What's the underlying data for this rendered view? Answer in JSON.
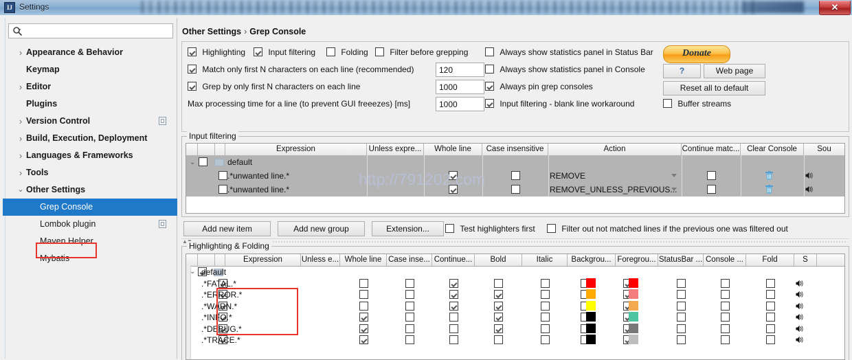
{
  "window": {
    "title": "Settings",
    "app_icon": "intellij-idea-icon",
    "close_label": "✕"
  },
  "sidebar": {
    "search": {
      "placeholder": "",
      "value": "",
      "icon": "search-icon"
    },
    "items": [
      {
        "label": "Appearance & Behavior",
        "level": 0,
        "arrow": "›",
        "selected": false,
        "copy_icon": false
      },
      {
        "label": "Keymap",
        "level": 0,
        "arrow": "",
        "selected": false,
        "copy_icon": false
      },
      {
        "label": "Editor",
        "level": 0,
        "arrow": "›",
        "selected": false,
        "copy_icon": false
      },
      {
        "label": "Plugins",
        "level": 0,
        "arrow": "",
        "selected": false,
        "copy_icon": false
      },
      {
        "label": "Version Control",
        "level": 0,
        "arrow": "›",
        "selected": false,
        "copy_icon": true
      },
      {
        "label": "Build, Execution, Deployment",
        "level": 0,
        "arrow": "›",
        "selected": false,
        "copy_icon": false
      },
      {
        "label": "Languages & Frameworks",
        "level": 0,
        "arrow": "›",
        "selected": false,
        "copy_icon": false
      },
      {
        "label": "Tools",
        "level": 0,
        "arrow": "›",
        "selected": false,
        "copy_icon": false
      },
      {
        "label": "Other Settings",
        "level": 0,
        "arrow": "⌄",
        "selected": false,
        "copy_icon": false
      },
      {
        "label": "Grep Console",
        "level": 1,
        "arrow": "",
        "selected": true,
        "copy_icon": false
      },
      {
        "label": "Lombok plugin",
        "level": 1,
        "arrow": "",
        "selected": false,
        "copy_icon": true
      },
      {
        "label": "Maven Helper",
        "level": 1,
        "arrow": "",
        "selected": false,
        "copy_icon": false
      },
      {
        "label": "Mybatis",
        "level": 1,
        "arrow": "",
        "selected": false,
        "copy_icon": false
      }
    ]
  },
  "breadcrumb": {
    "parent": "Other Settings",
    "separator": "›",
    "current": "Grep Console"
  },
  "options": {
    "row1": [
      {
        "label": "Highlighting",
        "checked": true
      },
      {
        "label": "Input filtering",
        "checked": true
      },
      {
        "label": "Folding",
        "checked": false
      },
      {
        "label": "Filter before grepping",
        "checked": false
      },
      {
        "label": "Always show statistics panel in Status Bar",
        "checked": false
      }
    ],
    "row2": {
      "label": "Match only first N characters on each line (recommended)",
      "checked": true,
      "value": "120",
      "right": {
        "label": "Always show statistics panel in Console",
        "checked": false
      }
    },
    "row3": {
      "label": "Grep by only first N characters on each line",
      "checked": true,
      "value": "1000",
      "right": {
        "label": "Always pin grep consoles",
        "checked": true
      }
    },
    "row4": {
      "label": "Max processing time for a line (to prevent GUI freeezes) [ms]",
      "value": "1000",
      "right": {
        "label": "Input filtering - blank line workaround",
        "checked": true
      }
    },
    "buffer_streams": {
      "label": "Buffer streams",
      "checked": false
    },
    "donate_label": "Donate",
    "help_label": "?",
    "web_page_label": "Web page",
    "reset_label": "Reset all to default"
  },
  "input_filtering": {
    "group_title": "Input filtering",
    "columns": [
      "",
      "",
      "",
      "Expression",
      "Unless expre...",
      "Whole line",
      "Case insensitive",
      "Action",
      "Continue matc...",
      "Clear Console",
      "Sou"
    ],
    "rows": [
      {
        "type": "group",
        "expand": "⌄",
        "checked": false,
        "folder": true,
        "expression": "default",
        "unless": "",
        "whole_line": null,
        "case_insensitive": null,
        "action": "",
        "continue_match": null,
        "clear_console": false,
        "sound": false
      },
      {
        "type": "item",
        "checked": false,
        "expression": ".*unwanted line.*",
        "unless": "",
        "whole_line": true,
        "case_insensitive": false,
        "action": "REMOVE",
        "continue_match": false,
        "clear_console": true,
        "sound": true
      },
      {
        "type": "item",
        "checked": false,
        "expression": ".*unwanted line.*",
        "unless": "",
        "whole_line": true,
        "case_insensitive": false,
        "action": "REMOVE_UNLESS_PREVIOUS...",
        "continue_match": false,
        "clear_console": true,
        "sound": true
      }
    ],
    "buttons": [
      {
        "label": "Add new item"
      },
      {
        "label": "Add new group"
      },
      {
        "label": "Extension..."
      }
    ],
    "checkboxes": [
      {
        "label": "Test highlighters first",
        "checked": false
      },
      {
        "label": "Filter out not matched lines if the previous one was filtered out",
        "checked": false
      }
    ]
  },
  "highlighting": {
    "group_title": "Highlighting & Folding",
    "columns": [
      "",
      "",
      "",
      "Expression",
      "Unless e...",
      "Whole line",
      "Case inse...",
      "Continue...",
      "Bold",
      "Italic",
      "Backgrou...",
      "Foregrou...",
      "StatusBar ...",
      "Console ...",
      "Fold",
      "S"
    ],
    "rows": [
      {
        "type": "group",
        "expand": "⌄",
        "checked": true,
        "folder": true,
        "expression": "default"
      },
      {
        "type": "item",
        "checked": true,
        "expression": ".*FATAL.*",
        "whole_line": false,
        "case_insensitive": false,
        "continue_match": true,
        "bold": false,
        "italic": false,
        "bg_checked": false,
        "bg_color": "#FF0000",
        "fg_checked": true,
        "fg_color": "#FF0000",
        "statusbar": false,
        "console": false,
        "fold": false,
        "sound": true,
        "boxed": false
      },
      {
        "type": "item",
        "checked": true,
        "expression": ".*ERROR.*",
        "whole_line": false,
        "case_insensitive": false,
        "continue_match": true,
        "bold": true,
        "italic": false,
        "bg_checked": false,
        "bg_color": "#FFAA00",
        "fg_checked": true,
        "fg_color": "#F47C7C",
        "statusbar": false,
        "console": false,
        "fold": false,
        "sound": true,
        "boxed": true
      },
      {
        "type": "item",
        "checked": true,
        "expression": ".*WARN.*",
        "whole_line": false,
        "case_insensitive": false,
        "continue_match": true,
        "bold": true,
        "italic": false,
        "bg_checked": false,
        "bg_color": "#FFFF00",
        "fg_checked": true,
        "fg_color": "#F2A950",
        "statusbar": false,
        "console": false,
        "fold": false,
        "sound": true,
        "boxed": true
      },
      {
        "type": "item",
        "checked": true,
        "expression": ".*INFO.*",
        "whole_line": true,
        "case_insensitive": false,
        "continue_match": false,
        "bold": true,
        "italic": false,
        "bg_checked": false,
        "bg_color": "#000000",
        "fg_checked": true,
        "fg_color": "#4FC4A0",
        "statusbar": false,
        "console": false,
        "fold": false,
        "sound": true,
        "boxed": true
      },
      {
        "type": "item",
        "checked": true,
        "expression": ".*DEBUG.*",
        "whole_line": true,
        "case_insensitive": false,
        "continue_match": false,
        "bold": true,
        "italic": false,
        "bg_checked": false,
        "bg_color": "#000000",
        "fg_checked": true,
        "fg_color": "#787878",
        "statusbar": false,
        "console": false,
        "fold": false,
        "sound": true,
        "boxed": true
      },
      {
        "type": "item",
        "checked": true,
        "expression": ".*TRACE.*",
        "whole_line": true,
        "case_insensitive": false,
        "continue_match": false,
        "bold": false,
        "italic": false,
        "bg_checked": false,
        "bg_color": "#000000",
        "fg_checked": true,
        "fg_color": "#BDBDBD",
        "statusbar": false,
        "console": false,
        "fold": false,
        "sound": true,
        "boxed": false
      }
    ]
  },
  "watermark": "http://791202.com",
  "colors": {
    "selection_blue": "#1f78c8",
    "highlight_box_red": "#e8342b",
    "donate_orange": "#f59d16"
  }
}
